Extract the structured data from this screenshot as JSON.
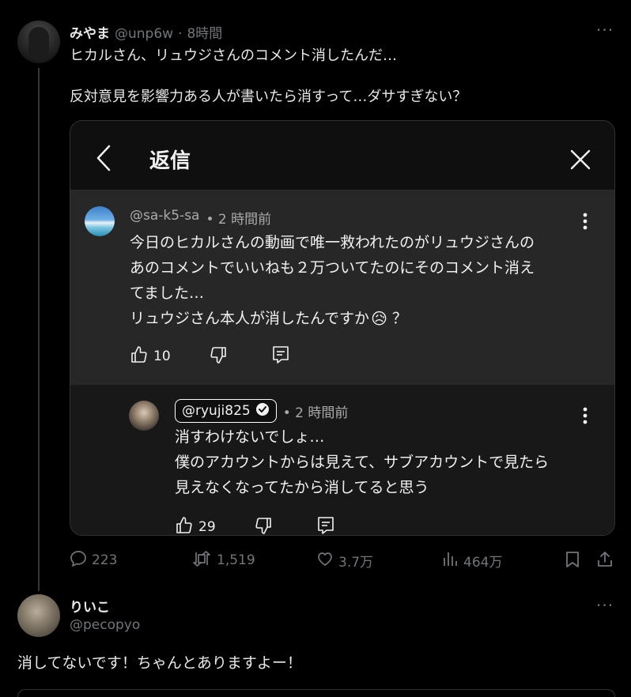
{
  "post1": {
    "name": "みやま",
    "handle": "@unp6w",
    "sep": "·",
    "time": "8時間",
    "line1": "ヒカルさん、リュウジさんのコメント消したんだ…",
    "line2": "反対意見を影響力ある人が書いたら消すって…ダサすぎない？",
    "more": "···"
  },
  "embed": {
    "header_title": "返信",
    "comment": {
      "handle": "@sa-k5-sa",
      "time": "• 2 時間前",
      "line1": "今日のヒカルさんの動画で唯一救われたのがリュウジさんの",
      "line2": "あのコメントでいいねも２万ついてたのにそのコメント消え",
      "line3": "てました…",
      "line4": "リュウジさん本人が消したんですか",
      "line4_emoji": "😥",
      "line4_end": "？",
      "likes": "10"
    },
    "reply": {
      "handle": "@ryuji825",
      "time": "• 2 時間前",
      "line1": "消すわけないでしょ…",
      "line2": "僕のアカウントからは見えて、サブアカウントで見たら",
      "line3": "見えなくなってたから消してると思う",
      "likes": "29"
    }
  },
  "actions": {
    "replies": "223",
    "reposts": "1,519",
    "likes": "3.7万",
    "views": "464万"
  },
  "post2": {
    "name": "りいこ",
    "handle": "@pecopyo",
    "text": "消してないです！ちゃんとありますよー！",
    "more": "···"
  },
  "colors": {
    "background": "#000000",
    "text": "#e7e9ea",
    "muted": "#71767b",
    "embed_comment_bg": "#272727",
    "embed_reply_bg": "#181818"
  }
}
